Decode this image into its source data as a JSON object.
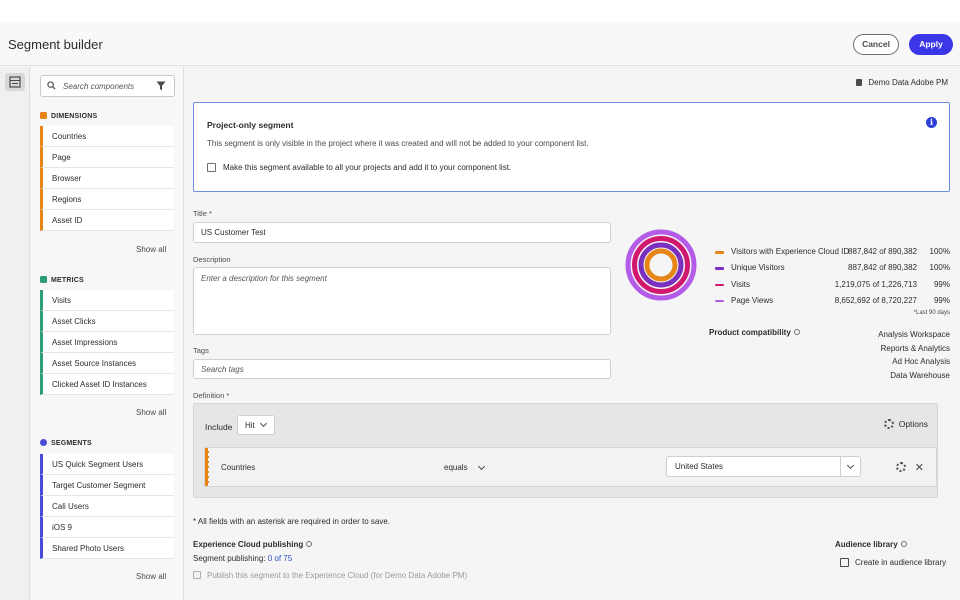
{
  "header": {
    "title": "Segment builder",
    "cancel_label": "Cancel",
    "apply_label": "Apply"
  },
  "sidebar": {
    "search_placeholder": "Search components",
    "dimensions": {
      "heading": "DIMENSIONS",
      "items": [
        "Countries",
        "Page",
        "Browser",
        "Regions",
        "Asset ID"
      ],
      "show_all": "Show all"
    },
    "metrics": {
      "heading": "METRICS",
      "items": [
        "Visits",
        "Asset Clicks",
        "Asset Impressions",
        "Asset Source Instances",
        "Clicked Asset ID Instances"
      ],
      "show_all": "Show all"
    },
    "segments": {
      "heading": "SEGMENTS",
      "items": [
        "US Quick Segment Users",
        "Target Customer Segment",
        "Cali Users",
        "iOS 9",
        "Shared Photo Users"
      ],
      "show_all": "Show all"
    }
  },
  "main": {
    "data_view": "Demo Data Adobe PM",
    "notice": {
      "title": "Project-only segment",
      "text": "This segment is only visible in the project where it was created and will not be added to your component list.",
      "checkbox_label": "Make this segment available to all your projects and add it to your component list."
    },
    "title_label": "Title *",
    "title_value": "US Customer Test",
    "description_label": "Description",
    "description_placeholder": "Enter a description for this segment",
    "tags_label": "Tags",
    "tags_placeholder": "Search tags",
    "definition_label": "Definition *",
    "summary": {
      "rows": [
        {
          "name": "Visitors with Experience Cloud ID",
          "value": "887,842 of 890,382",
          "pct": "100%",
          "color": "#e68619"
        },
        {
          "name": "Unique Visitors",
          "value": "887,842 of 890,382",
          "pct": "100%",
          "color": "#7b2fbf"
        },
        {
          "name": "Visits",
          "value": "1,219,075 of 1,226,713",
          "pct": "99%",
          "color": "#d0186e"
        },
        {
          "name": "Page Views",
          "value": "8,652,692 of 8,720,227",
          "pct": "99%",
          "color": "#b45be8"
        }
      ],
      "last_note": "*Last 90 days",
      "compat_label": "Product compatibility",
      "compat_items": [
        "Analysis Workspace",
        "Reports & Analytics",
        "Ad Hoc Analysis",
        "Data Warehouse"
      ]
    },
    "definition": {
      "include_label": "Include",
      "container": "Hit",
      "options_label": "Options",
      "rule": {
        "dimension": "Countries",
        "operator": "equals",
        "value": "United States"
      }
    },
    "required_note": "* All fields with an asterisk are required in order to save.",
    "ec_publishing": {
      "label": "Experience Cloud publishing",
      "sub_prefix": "Segment publishing: ",
      "count": "0 of 75",
      "checkbox_label": "Publish this segment to the Experience Cloud (for Demo Data Adobe PM)"
    },
    "audience": {
      "label": "Audience library",
      "link": "Create in audience library"
    }
  }
}
